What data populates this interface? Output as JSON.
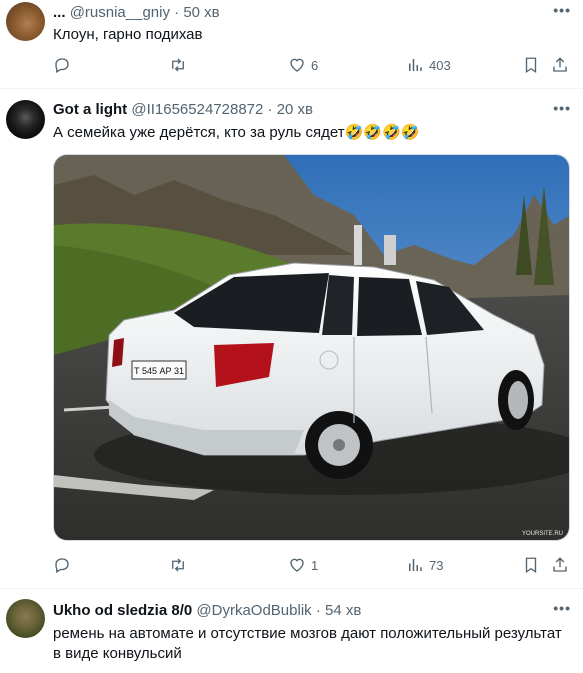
{
  "tweets": [
    {
      "author_name": "...",
      "handle": "@rusnia__gniy",
      "time": "50 хв",
      "text": "Клоун, гарно подихав",
      "replies": "",
      "retweets": "",
      "likes": "6",
      "views": "403"
    },
    {
      "author_name": "Got a light",
      "handle": "@II1656524728872",
      "time": "20 хв",
      "text": "А семейка уже дерётся, кто за руль сядет🤣🤣🤣🤣",
      "media_watermark": "YOURSITE.RU",
      "plate": "Т 545 АР 31",
      "replies": "",
      "retweets": "",
      "likes": "1",
      "views": "73"
    },
    {
      "author_name": "Ukho od sledzia 8/0",
      "handle": "@DyrkaOdBublik",
      "time": "54 хв",
      "text_line1": "ремень на автомате и отсутствие мозгов дают положительный результат",
      "text_line2": "в виде конвульсий"
    }
  ],
  "icons": [
    "more-icon",
    "reply-icon",
    "retweet-icon",
    "like-icon",
    "views-icon",
    "bookmark-icon",
    "share-icon"
  ],
  "colors": {
    "text": "#0f1419",
    "muted": "#536471",
    "divider": "#eff3f4"
  }
}
